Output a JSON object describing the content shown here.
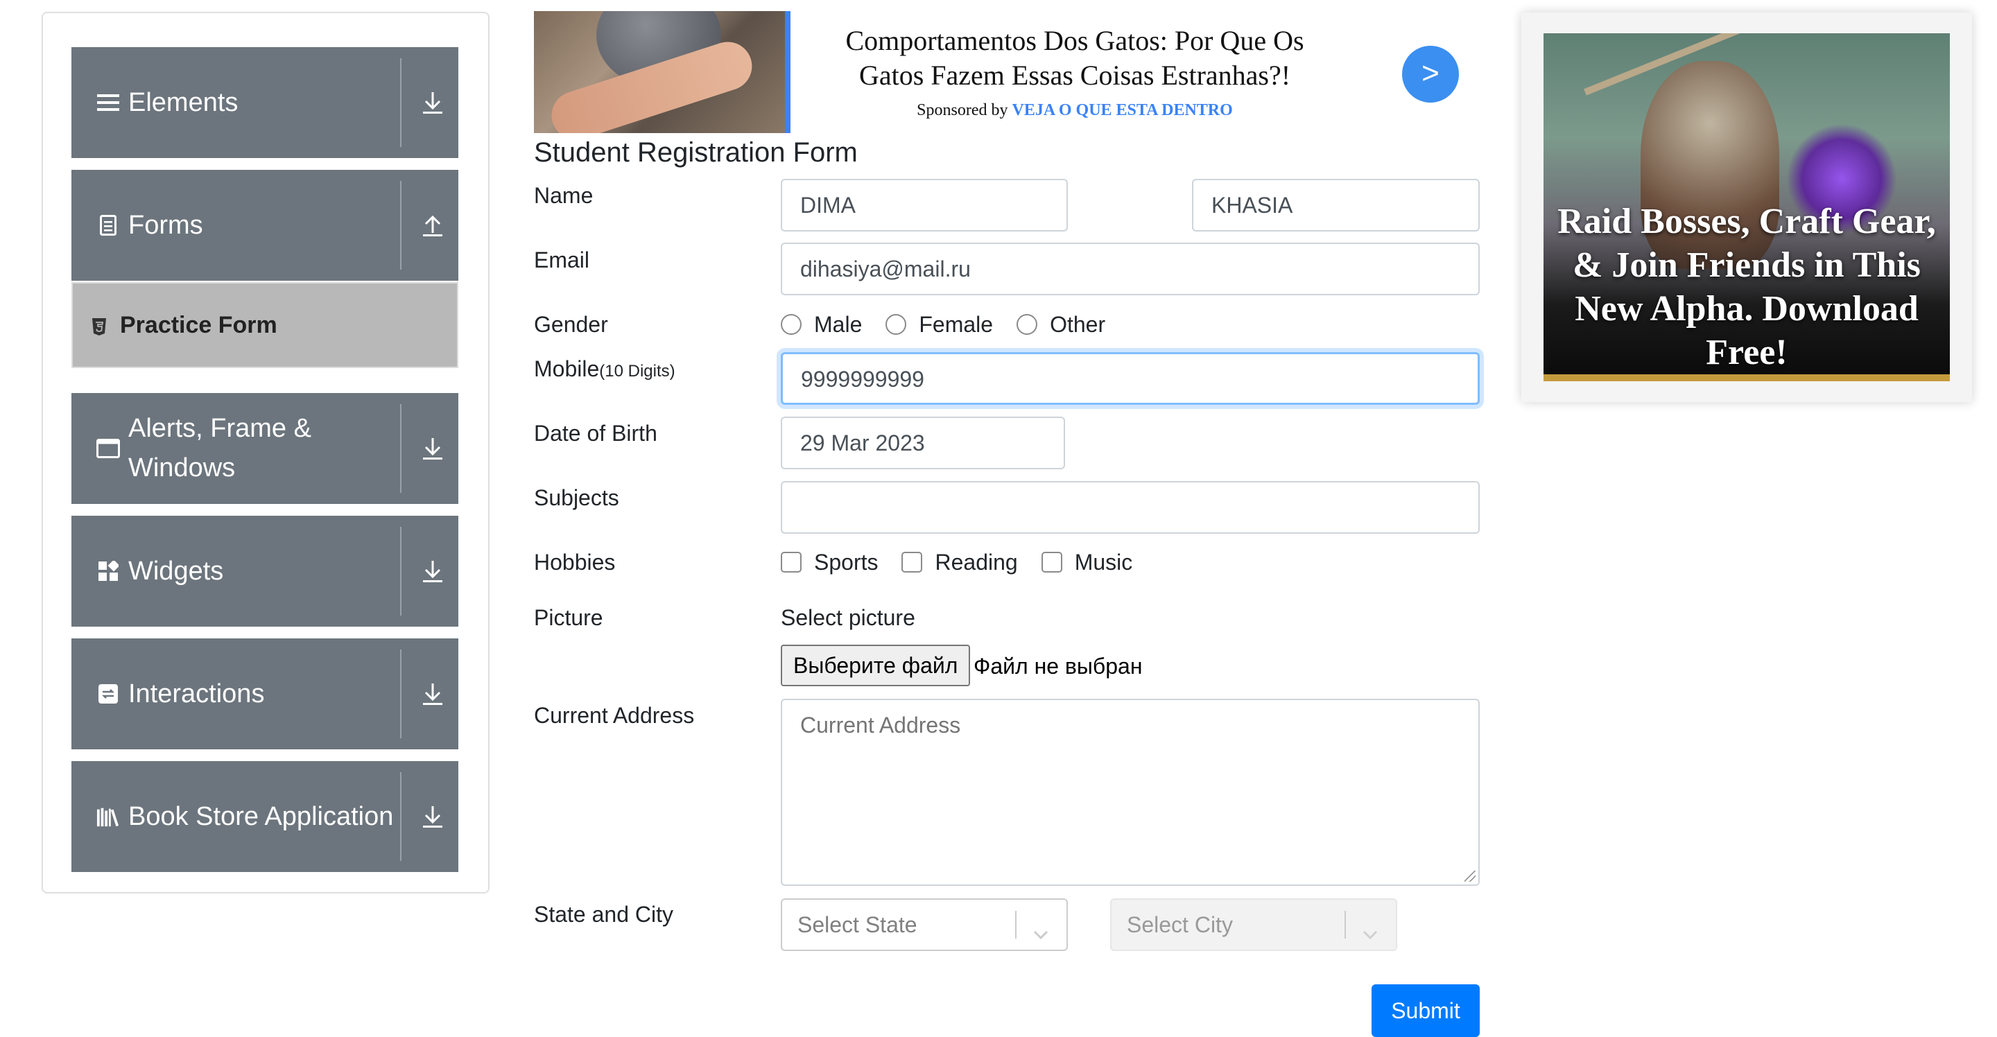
{
  "sidebar": {
    "groups": [
      {
        "label": "Elements",
        "icon": "list-icon",
        "arrow": "arrow-down-icon"
      },
      {
        "label": "Forms",
        "icon": "document-icon",
        "arrow": "arrow-up-icon"
      },
      {
        "label": "Alerts, Frame & Windows",
        "icon": "window-icon",
        "arrow": "arrow-down-icon"
      },
      {
        "label": "Widgets",
        "icon": "widgets-icon",
        "arrow": "arrow-down-icon"
      },
      {
        "label": "Interactions",
        "icon": "interactions-icon",
        "arrow": "arrow-down-icon"
      },
      {
        "label": "Book Store Application",
        "icon": "books-icon",
        "arrow": "arrow-down-icon"
      }
    ],
    "active_item": {
      "label": "Practice Form",
      "icon": "html5-icon"
    }
  },
  "ad_banner": {
    "title": "Comportamentos Dos Gatos: Por Que Os Gatos Fazem Essas Coisas Estranhas?!",
    "sponsor_prefix": "Sponsored by",
    "sponsor_brand": "VEJA O QUE ESTA DENTRO",
    "go_button": ">"
  },
  "form": {
    "title": "Student Registration Form",
    "name": {
      "label": "Name",
      "first_value": "DIMA",
      "last_value": "KHASIA"
    },
    "email": {
      "label": "Email",
      "value": "dihasiya@mail.ru"
    },
    "gender": {
      "label": "Gender",
      "options": [
        "Male",
        "Female",
        "Other"
      ]
    },
    "mobile": {
      "label": "Mobile",
      "hint": "(10 Digits)",
      "value": "9999999999"
    },
    "dob": {
      "label": "Date of Birth",
      "value": "29 Mar 2023"
    },
    "subjects": {
      "label": "Subjects",
      "value": ""
    },
    "hobbies": {
      "label": "Hobbies",
      "options": [
        "Sports",
        "Reading",
        "Music"
      ]
    },
    "picture": {
      "label": "Picture",
      "prompt": "Select picture",
      "button": "Выберите файл",
      "status": "Файл не выбран"
    },
    "address": {
      "label": "Current Address",
      "placeholder": "Current Address"
    },
    "state_city": {
      "label": "State and City",
      "state_placeholder": "Select State",
      "city_placeholder": "Select City"
    },
    "submit": "Submit"
  },
  "side_ad": {
    "text": "Raid Bosses, Craft Gear, & Join Friends in This New Alpha. Download Free!"
  },
  "colors": {
    "sidebar_group": "#6c757d",
    "sidebar_active": "#b8b8b8",
    "primary": "#007bff",
    "focus_border": "#80bdff"
  }
}
